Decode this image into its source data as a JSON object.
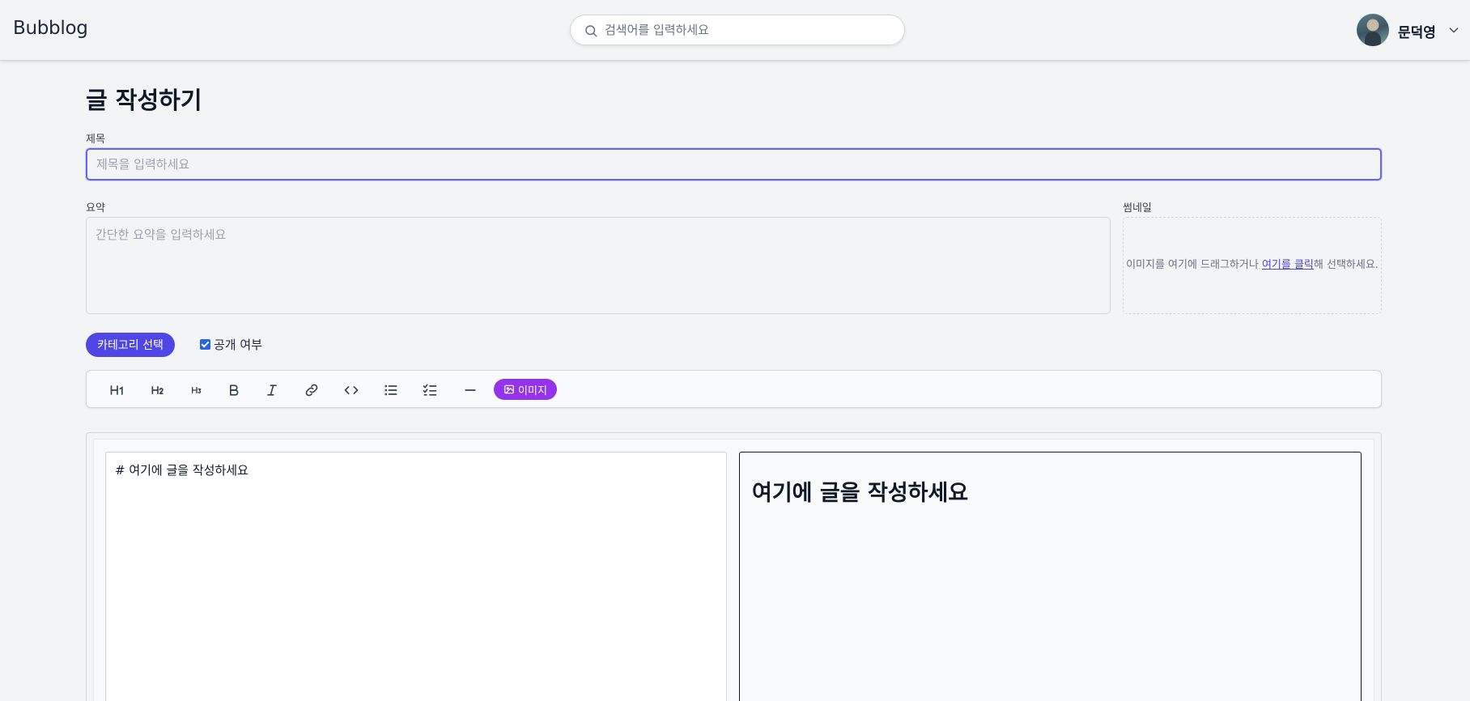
{
  "header": {
    "logo": "Bubblog",
    "search_placeholder": "검색어를 입력하세요",
    "user_name": "문덕영"
  },
  "page": {
    "title": "글 작성하기"
  },
  "form": {
    "title_label": "제목",
    "title_placeholder": "제목을 입력하세요",
    "summary_label": "요약",
    "summary_placeholder": "간단한 요약을 입력하세요",
    "thumbnail_label": "썸네일",
    "thumbnail_text_before": "이미지를 여기에 드래그하거나 ",
    "thumbnail_link": "여기를 클릭",
    "thumbnail_text_after": "해 선택하세요.",
    "category_button": "카테고리 선택",
    "public_label": "공개 여부",
    "public_checked": true
  },
  "toolbar": {
    "image_button": "이미지"
  },
  "editor": {
    "markdown": "# 여기에 글을 작성하세요",
    "preview_heading": "여기에 글을 작성하세요"
  },
  "colors": {
    "accent": "#4f46e5",
    "image_button": "#9333ea",
    "focus_border": "#6366f1"
  }
}
